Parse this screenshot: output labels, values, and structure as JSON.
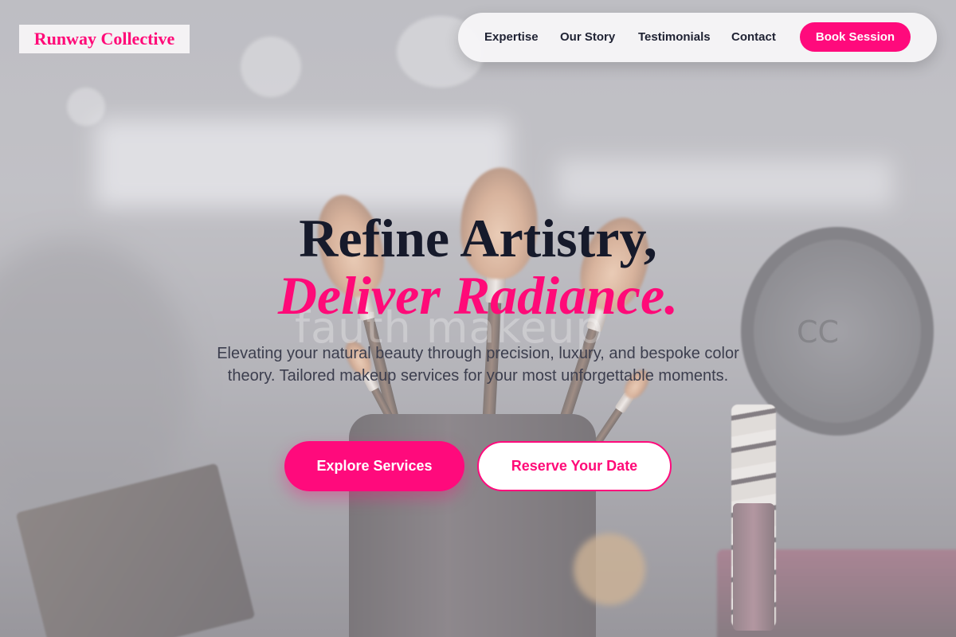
{
  "brand": {
    "name": "Runway Collective",
    "accent_color": "#ff0a78"
  },
  "nav": {
    "links": [
      "Expertise",
      "Our Story",
      "Testimonials",
      "Contact"
    ],
    "cta_label": "Book Session"
  },
  "hero": {
    "title_line1": "Refine Artistry,",
    "title_line2": "Deliver Radiance.",
    "subtitle": "Elevating your natural beauty through precision, luxury, and bespoke color theory. Tailored makeup services for your most unforgettable moments.",
    "primary_button": "Explore Services",
    "secondary_button": "Reserve Your Date",
    "background_photo_text": "fauth makeup"
  }
}
